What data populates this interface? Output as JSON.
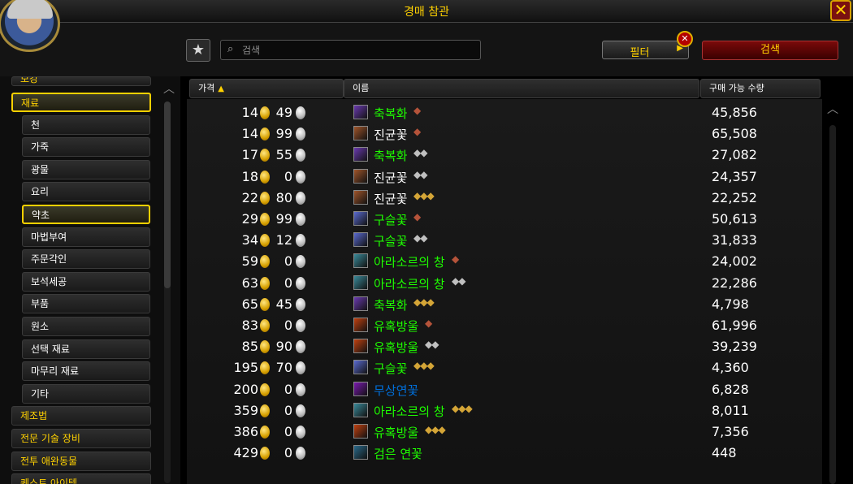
{
  "window": {
    "title": "경매 참관",
    "close_glyph": "✕"
  },
  "toolbar": {
    "favorites_glyph": "★",
    "search_placeholder": "검색",
    "search_icon": "🔍",
    "filter_label": "필터",
    "filter_arrow": "▶",
    "filter_clear_glyph": "✕",
    "search_button_label": "검색"
  },
  "colors": {
    "gold_text": "#ffd100",
    "common_item": "#ffffff",
    "uncommon_item": "#1eff00",
    "rare_item": "#0070dd"
  },
  "categories": [
    {
      "label": "보강",
      "level": "top",
      "selected": false,
      "partial": true
    },
    {
      "label": "재료",
      "level": "top",
      "selected": true
    },
    {
      "label": "천",
      "level": "sub",
      "selected": false
    },
    {
      "label": "가죽",
      "level": "sub",
      "selected": false
    },
    {
      "label": "광물",
      "level": "sub",
      "selected": false
    },
    {
      "label": "요리",
      "level": "sub",
      "selected": false
    },
    {
      "label": "약초",
      "level": "sub",
      "selected": true
    },
    {
      "label": "마법부여",
      "level": "sub",
      "selected": false
    },
    {
      "label": "주문각인",
      "level": "sub",
      "selected": false
    },
    {
      "label": "보석세공",
      "level": "sub",
      "selected": false
    },
    {
      "label": "부품",
      "level": "sub",
      "selected": false
    },
    {
      "label": "원소",
      "level": "sub",
      "selected": false
    },
    {
      "label": "선택 재료",
      "level": "sub",
      "selected": false
    },
    {
      "label": "마무리 재료",
      "level": "sub",
      "selected": false
    },
    {
      "label": "기타",
      "level": "sub",
      "selected": false
    },
    {
      "label": "제조법",
      "level": "top",
      "selected": false
    },
    {
      "label": "전문 기술 장비",
      "level": "top",
      "selected": false
    },
    {
      "label": "전투 애완동물",
      "level": "top",
      "selected": false
    },
    {
      "label": "퀘스트 아이템",
      "level": "top",
      "selected": false,
      "partial": true
    }
  ],
  "columns": {
    "price": "가격",
    "price_sort_icon": "▲",
    "name": "이름",
    "quantity": "구매 가능 수량"
  },
  "rows": [
    {
      "gold": "14",
      "silver": "49",
      "name": "축복화",
      "quality": 1,
      "rarity": "uncommon",
      "icon": "flower-icon",
      "qty": "45,856"
    },
    {
      "gold": "14",
      "silver": "99",
      "name": "진균꽃",
      "quality": 1,
      "rarity": "common",
      "icon": "fungus-icon",
      "qty": "65,508"
    },
    {
      "gold": "17",
      "silver": "55",
      "name": "축복화",
      "quality": 2,
      "rarity": "uncommon",
      "icon": "flower-icon",
      "qty": "27,082"
    },
    {
      "gold": "18",
      "silver": "0",
      "name": "진균꽃",
      "quality": 2,
      "rarity": "common",
      "icon": "fungus-icon",
      "qty": "24,357"
    },
    {
      "gold": "22",
      "silver": "80",
      "name": "진균꽃",
      "quality": 3,
      "rarity": "common",
      "icon": "fungus-icon",
      "qty": "22,252"
    },
    {
      "gold": "29",
      "silver": "99",
      "name": "구슬꽃",
      "quality": 1,
      "rarity": "uncommon",
      "icon": "orb-flower-icon",
      "qty": "50,613"
    },
    {
      "gold": "34",
      "silver": "12",
      "name": "구슬꽃",
      "quality": 2,
      "rarity": "uncommon",
      "icon": "orb-flower-icon",
      "qty": "31,833"
    },
    {
      "gold": "59",
      "silver": "0",
      "name": "아라소르의 창",
      "quality": 1,
      "rarity": "uncommon",
      "icon": "spear-icon",
      "qty": "24,002"
    },
    {
      "gold": "63",
      "silver": "0",
      "name": "아라소르의 창",
      "quality": 2,
      "rarity": "uncommon",
      "icon": "spear-icon",
      "qty": "22,286"
    },
    {
      "gold": "65",
      "silver": "45",
      "name": "축복화",
      "quality": 3,
      "rarity": "uncommon",
      "icon": "flower-icon",
      "qty": "4,798"
    },
    {
      "gold": "83",
      "silver": "0",
      "name": "유혹방울",
      "quality": 1,
      "rarity": "uncommon",
      "icon": "droplet-icon",
      "qty": "61,996"
    },
    {
      "gold": "85",
      "silver": "90",
      "name": "유혹방울",
      "quality": 2,
      "rarity": "uncommon",
      "icon": "droplet-icon",
      "qty": "39,239"
    },
    {
      "gold": "195",
      "silver": "70",
      "name": "구슬꽃",
      "quality": 3,
      "rarity": "uncommon",
      "icon": "orb-flower-icon",
      "qty": "4,360"
    },
    {
      "gold": "200",
      "silver": "0",
      "name": "무상연꽃",
      "quality": 0,
      "rarity": "rare",
      "icon": "lotus-icon",
      "qty": "6,828"
    },
    {
      "gold": "359",
      "silver": "0",
      "name": "아라소르의 창",
      "quality": 3,
      "rarity": "uncommon",
      "icon": "spear-icon",
      "qty": "8,011"
    },
    {
      "gold": "386",
      "silver": "0",
      "name": "유혹방울",
      "quality": 3,
      "rarity": "uncommon",
      "icon": "droplet-icon",
      "qty": "7,356"
    },
    {
      "gold": "429",
      "silver": "0",
      "name": "검은 연꽃",
      "quality": 0,
      "rarity": "uncommon",
      "icon": "black-lotus-icon",
      "qty": "448"
    }
  ]
}
